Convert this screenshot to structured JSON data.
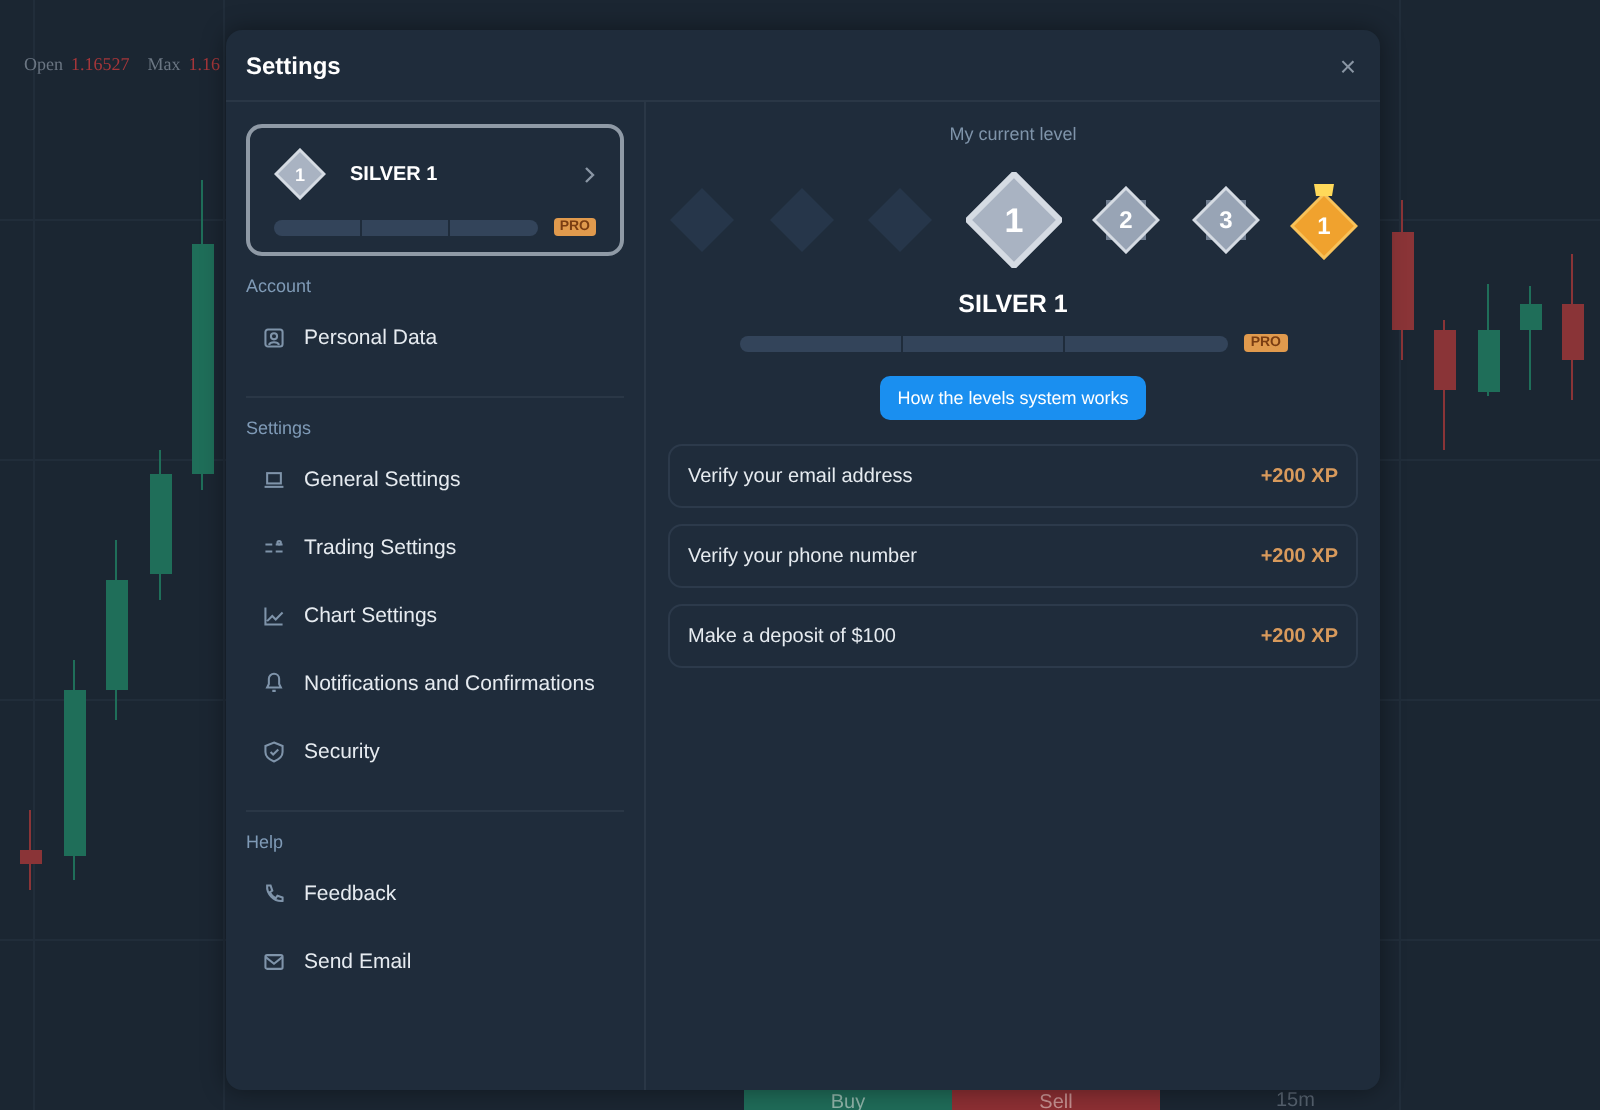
{
  "chart_header": {
    "open_label": "Open",
    "open_value": "1.16527",
    "max_label": "Max",
    "max_value": "1.16"
  },
  "bottom_toolbar": {
    "buy": "Buy",
    "sell": "Sell",
    "timeframe": "15m"
  },
  "window": {
    "title": "Settings",
    "close": "×"
  },
  "level_card": {
    "name": "SILVER 1",
    "badge_number": "1",
    "level": 0,
    "pro": "PRO"
  },
  "sidebar": {
    "sections": [
      {
        "title": "Account",
        "items": [
          {
            "label": "Personal Data"
          }
        ]
      },
      {
        "title": "Settings",
        "items": [
          {
            "label": "General Settings"
          },
          {
            "label": "Trading Settings"
          },
          {
            "label": "Chart Settings"
          },
          {
            "label": "Notifications and Confirmations"
          },
          {
            "label": "Security"
          }
        ]
      },
      {
        "title": "Help",
        "items": [
          {
            "label": "Feedback"
          },
          {
            "label": "Send Email"
          }
        ]
      }
    ]
  },
  "main": {
    "caption": "My current level",
    "levels": [
      {
        "kind": "locked"
      },
      {
        "kind": "locked"
      },
      {
        "kind": "locked"
      },
      {
        "kind": "current",
        "label": "1"
      },
      {
        "kind": "next",
        "label": "2"
      },
      {
        "kind": "next",
        "label": "3"
      },
      {
        "kind": "gold",
        "label": "1"
      }
    ],
    "level_name": "SILVER 1",
    "level": 0,
    "pro": "PRO",
    "info_button": "How the levels system works",
    "tasks": [
      {
        "label": "Verify your email address",
        "reward": "+200 XP"
      },
      {
        "label": "Verify your phone number",
        "reward": "+200 XP"
      },
      {
        "label": "Make a deposit of $100",
        "reward": "+200 XP"
      }
    ]
  }
}
